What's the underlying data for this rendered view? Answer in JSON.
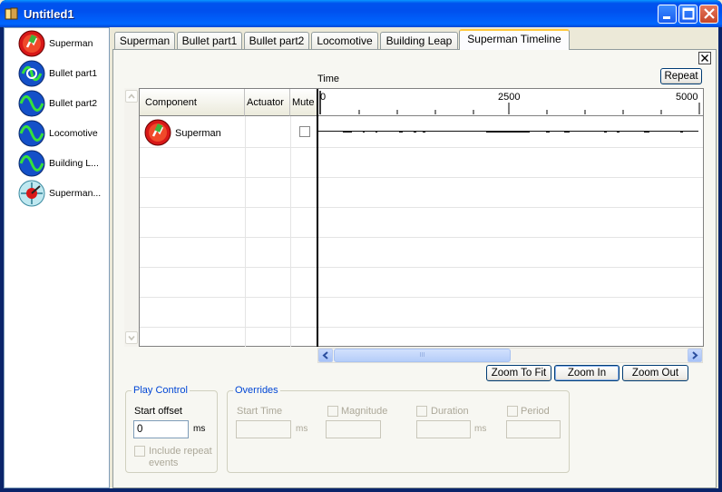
{
  "window": {
    "title": "Untitled1"
  },
  "components": [
    {
      "label": "Superman",
      "icon": "superman-effect-icon"
    },
    {
      "label": "Bullet part1",
      "icon": "bullet-effect-icon"
    },
    {
      "label": "Bullet part2",
      "icon": "wave-effect-icon"
    },
    {
      "label": "Locomotive",
      "icon": "wave-effect-icon"
    },
    {
      "label": "Building L...",
      "icon": "wave-effect-icon"
    },
    {
      "label": "Superman...",
      "icon": "timeline-effect-icon"
    }
  ],
  "tabs": [
    "Superman",
    "Bullet part1",
    "Bullet part2",
    "Locomotive",
    "Building Leap",
    "Superman Timeline"
  ],
  "active_tab": "Superman Timeline",
  "timeline": {
    "repeat_label": "Repeat",
    "time_label": "Time",
    "columns": {
      "component": "Component",
      "actuator": "Actuator",
      "mute": "Mute"
    },
    "ruler_ticks": [
      "0",
      "2500",
      "5000"
    ],
    "rows": [
      {
        "component": "Superman",
        "actuator": "",
        "mute": false
      }
    ],
    "scroll_grip": "III",
    "zoom_to_fit": "Zoom To Fit",
    "zoom_in": "Zoom In",
    "zoom_out": "Zoom Out"
  },
  "play_control": {
    "title": "Play Control",
    "start_offset_label": "Start offset",
    "start_offset_value": "0",
    "unit": "ms",
    "include_repeat_label": "Include repeat events"
  },
  "overrides": {
    "title": "Overrides",
    "start_time_label": "Start Time",
    "start_time_unit": "ms",
    "magnitude_label": "Magnitude",
    "duration_label": "Duration",
    "duration_unit": "ms",
    "period_label": "Period"
  },
  "colors": {
    "title_bar": "#0054e3",
    "accent": "#0046d5",
    "tab_highlight": "#ffc83c"
  }
}
